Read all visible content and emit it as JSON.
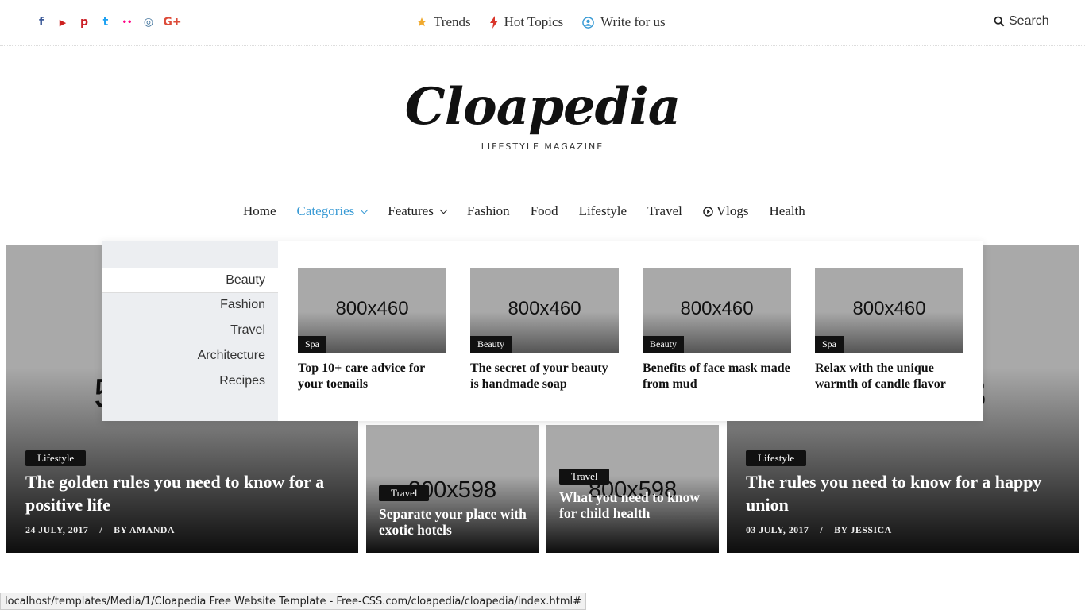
{
  "topbar": {
    "social": [
      {
        "icon": "facebook-icon",
        "glyph": "f",
        "color": "#3b5998"
      },
      {
        "icon": "youtube-icon",
        "glyph": "▶",
        "color": "#cd201f"
      },
      {
        "icon": "pinterest-icon",
        "glyph": "p",
        "color": "#cb2027"
      },
      {
        "icon": "twitter-icon",
        "glyph": "t",
        "color": "#1da1f2"
      },
      {
        "icon": "flickr-icon",
        "glyph": "••",
        "color": "#ff0084"
      },
      {
        "icon": "instagram-icon",
        "glyph": "◎",
        "color": "#3f729b"
      },
      {
        "icon": "google-plus-icon",
        "glyph": "G+",
        "color": "#dd4b39"
      }
    ],
    "links": {
      "trends": "Trends",
      "hot_topics": "Hot Topics",
      "write_for_us": "Write for us"
    },
    "search_label": "Search"
  },
  "logo": {
    "name": "Cloapedia",
    "tagline": "LIFESTYLE MAGAZINE"
  },
  "nav": {
    "home": "Home",
    "categories": "Categories",
    "features": "Features",
    "fashion": "Fashion",
    "food": "Food",
    "lifestyle": "Lifestyle",
    "travel": "Travel",
    "vlogs": "Vlogs",
    "health": "Health",
    "active_color": "#3a9bd5"
  },
  "mega": {
    "categories": [
      "Beauty",
      "Fashion",
      "Travel",
      "Architecture",
      "Recipes"
    ],
    "selected": "Beauty",
    "posts": [
      {
        "placeholder": "800x460",
        "badge": "Spa",
        "title": "Top 10+ care advice for your toenails"
      },
      {
        "placeholder": "800x460",
        "badge": "Beauty",
        "title": "The secret of your beauty is handmade soap"
      },
      {
        "placeholder": "800x460",
        "badge": "Beauty",
        "title": "Benefits of face mask made from mud"
      },
      {
        "placeholder": "800x460",
        "badge": "Spa",
        "title": "Relax with the unique warmth of candle flavor"
      }
    ]
  },
  "hero": {
    "left": {
      "placeholder_partial": "5",
      "badge": "Lifestyle",
      "title": "The golden rules you need to know for a positive life",
      "date": "24 JULY, 2017",
      "sep": "/",
      "author": "BY AMANDA"
    },
    "mid1": {
      "placeholder": "800x598",
      "badge": "Travel",
      "title": "Separate your place with exotic hotels"
    },
    "mid2": {
      "placeholder": "800x598",
      "badge": "Travel",
      "title": "What you need to know for child health"
    },
    "right": {
      "placeholder_partial": "8",
      "badge": "Lifestyle",
      "title": "The rules you need to know for a happy union",
      "date": "03 JULY, 2017",
      "sep": "/",
      "author": "BY JESSICA"
    }
  },
  "status_url": "localhost/templates/Media/1/Cloapedia Free Website Template - Free-CSS.com/cloapedia/cloapedia/index.html#"
}
